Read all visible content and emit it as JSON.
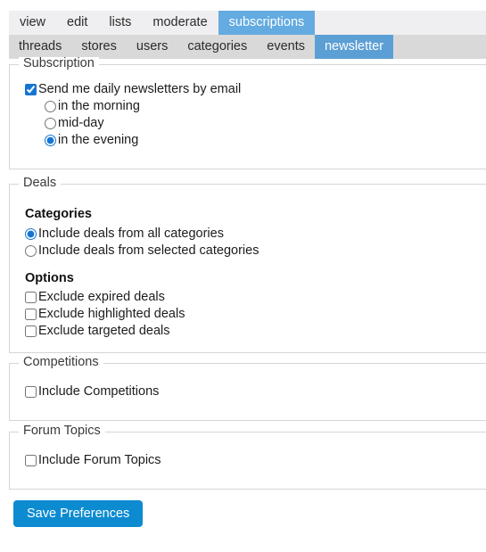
{
  "tabs": {
    "primary": [
      {
        "label": "view",
        "active": false
      },
      {
        "label": "edit",
        "active": false
      },
      {
        "label": "lists",
        "active": false
      },
      {
        "label": "moderate",
        "active": false
      },
      {
        "label": "subscriptions",
        "active": true
      }
    ],
    "secondary": [
      {
        "label": "threads",
        "active": false
      },
      {
        "label": "stores",
        "active": false
      },
      {
        "label": "users",
        "active": false
      },
      {
        "label": "categories",
        "active": false
      },
      {
        "label": "events",
        "active": false
      },
      {
        "label": "newsletter",
        "active": true
      }
    ]
  },
  "sections": {
    "subscription": {
      "legend": "Subscription",
      "newsletter_checkbox": {
        "label": "Send me daily newsletters by email",
        "checked": true
      },
      "time_options": [
        {
          "label": "in the morning",
          "checked": false
        },
        {
          "label": "mid-day",
          "checked": false
        },
        {
          "label": "in the evening",
          "checked": true
        }
      ]
    },
    "deals": {
      "legend": "Deals",
      "categories_heading": "Categories",
      "categories_options": [
        {
          "label": "Include deals from all categories",
          "checked": true
        },
        {
          "label": "Include deals from selected categories",
          "checked": false
        }
      ],
      "options_heading": "Options",
      "options_checkboxes": [
        {
          "label": "Exclude expired deals",
          "checked": false
        },
        {
          "label": "Exclude highlighted deals",
          "checked": false
        },
        {
          "label": "Exclude targeted deals",
          "checked": false
        }
      ]
    },
    "competitions": {
      "legend": "Competitions",
      "checkbox": {
        "label": "Include Competitions",
        "checked": false
      }
    },
    "forum_topics": {
      "legend": "Forum Topics",
      "checkbox": {
        "label": "Include Forum Topics",
        "checked": false
      }
    }
  },
  "actions": {
    "save_label": "Save Preferences"
  },
  "colors": {
    "accent_blue": "#0c8bd1",
    "tab_active_primary": "#63abe0",
    "tab_active_secondary": "#5c9fd4",
    "tabbar_primary_bg": "#efeff1",
    "tabbar_secondary_bg": "#d9d9d9",
    "fieldset_border": "#d6d6d6"
  }
}
